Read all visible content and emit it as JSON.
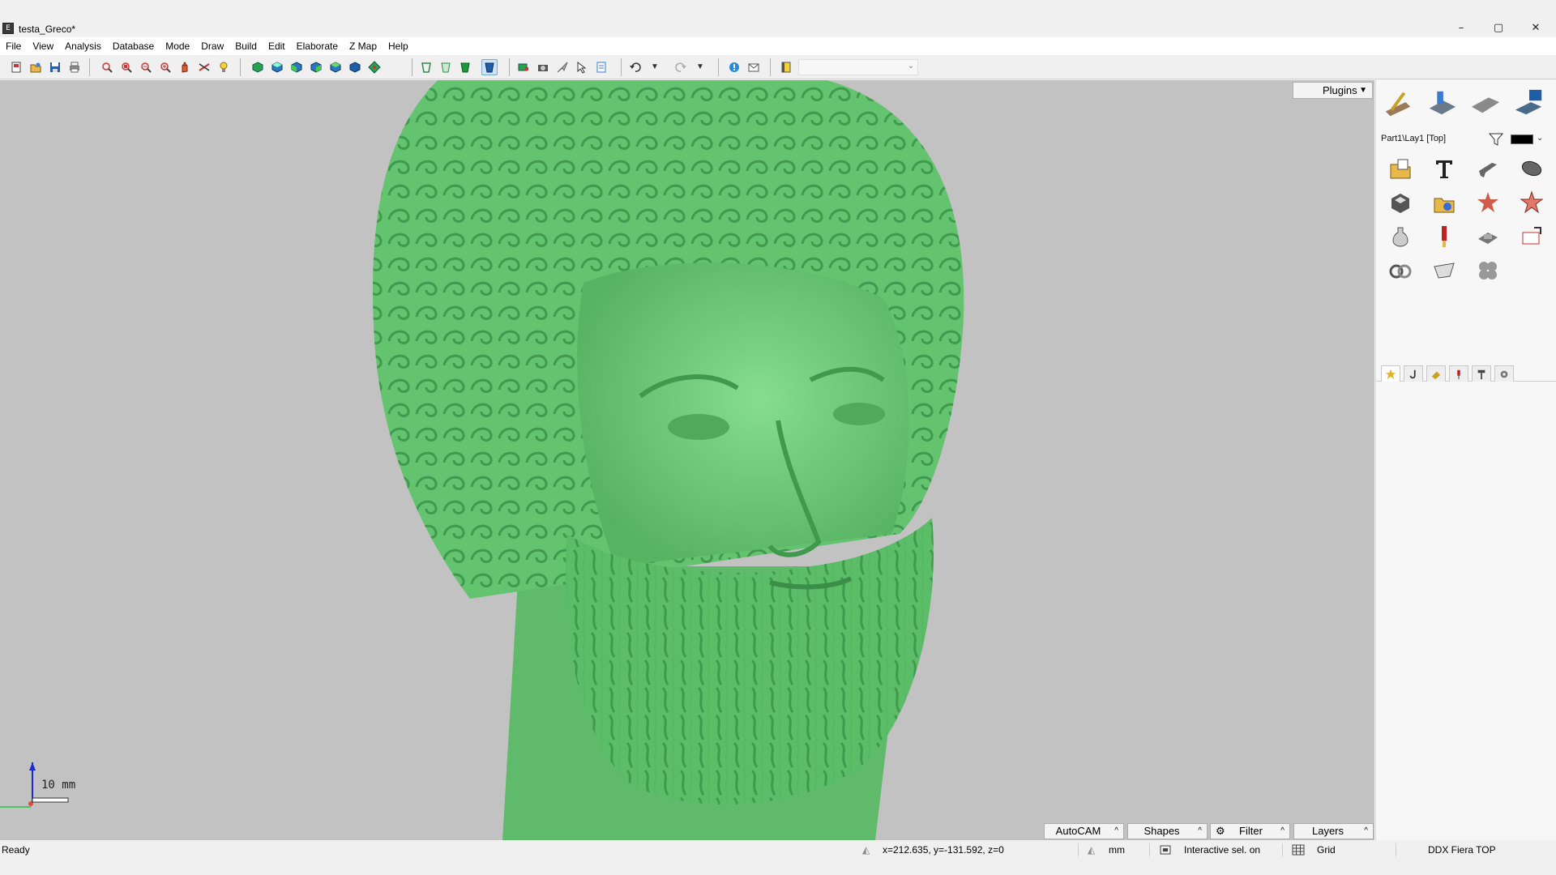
{
  "window": {
    "title": "testa_Greco*",
    "app_icon_glyph": "E",
    "controls": {
      "minimize": "–",
      "maximize": "▢",
      "close": "✕"
    }
  },
  "menu": [
    "File",
    "View",
    "Analysis",
    "Database",
    "Mode",
    "Draw",
    "Build",
    "Edit",
    "Elaborate",
    "Z Map",
    "Help"
  ],
  "toolbar": {
    "combo_value": "",
    "icons": [
      "new-file-icon",
      "open-file-icon",
      "save-icon",
      "print-icon",
      "zoom-window-icon",
      "zoom-all-icon",
      "zoom-out-icon",
      "zoom-in-icon",
      "pan-hand-icon",
      "measure-icon",
      "light-bulb-icon",
      "view-front-icon",
      "view-back-icon",
      "view-left-icon",
      "view-right-icon",
      "view-top-icon",
      "view-bottom-icon",
      "view-iso-icon",
      "shade-wire-icon",
      "shade-solid-icon",
      "shade-green-icon",
      "shade-active-icon",
      "render-icon",
      "camera-icon",
      "arrow-icon",
      "select-tool-icon",
      "properties-icon",
      "undo-icon",
      "redo-icon",
      "help-icon",
      "mail-icon",
      "book-icon"
    ]
  },
  "viewport": {
    "model_color": "#6fce7a",
    "background_color": "#c2c2c2",
    "plugins_label": "Plugins",
    "scale_label": "10 mm"
  },
  "bottom_tabs": [
    {
      "label": "AutoCAM"
    },
    {
      "label": "Shapes"
    },
    {
      "label": "Filter"
    },
    {
      "label": "Layers"
    }
  ],
  "right_panel": {
    "layer_label": "Part1\\Lay1 [Top]",
    "big_icons": [
      "cam-tool-icon",
      "machine-icon",
      "plate-icon",
      "workstation-icon"
    ],
    "tools": [
      "folder-import-icon",
      "text-tool-icon",
      "chamfer-tool-icon",
      "ellipse-tool-icon",
      "box-tool-icon",
      "gear-folder-icon",
      "star-red-icon",
      "star-outline-icon",
      "bottle-icon",
      "marker-icon",
      "tray-icon",
      "output-icon",
      "rings-icon",
      "cut-tool-icon",
      "flower-pattern-icon"
    ],
    "tabs": [
      "star-tab-icon",
      "hook-tab-icon",
      "eraser-tab-icon",
      "pin-tab-icon",
      "hammer-tab-icon",
      "gear-tab-icon"
    ]
  },
  "status": {
    "ready": "Ready",
    "coords": "x=212.635, y=-131.592, z=0",
    "units": "mm",
    "interactive": "Interactive sel. on",
    "grid": "Grid",
    "profile": "DDX Fiera TOP"
  }
}
